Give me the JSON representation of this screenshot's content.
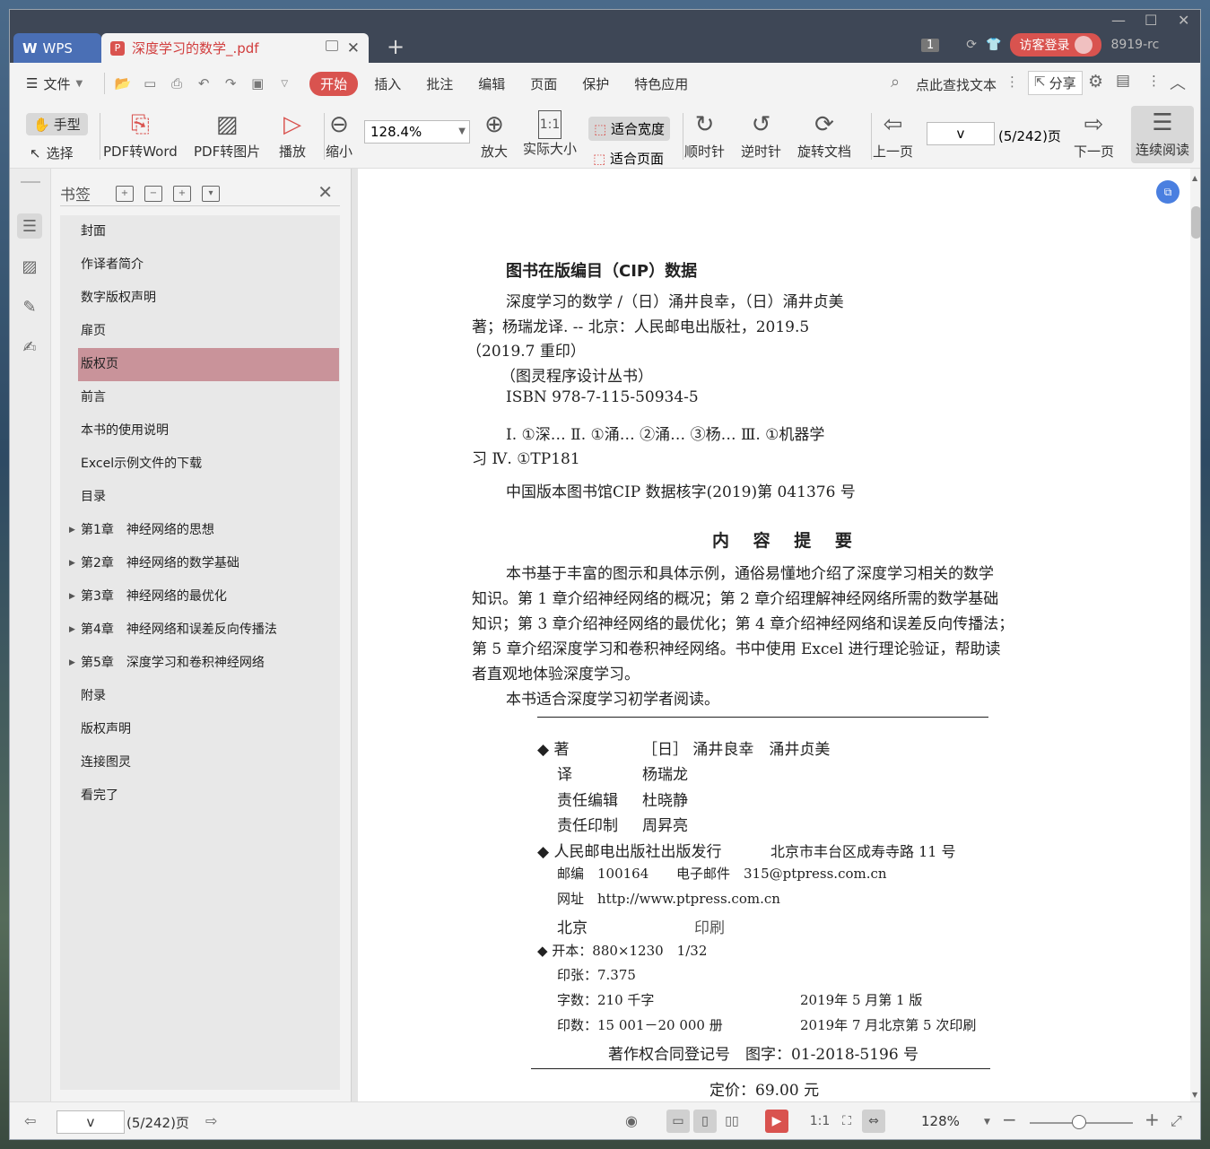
{
  "titlebar": {
    "wps_tab": "WPS",
    "doc_tab": "深度学习的数学_.pdf",
    "page_badge": "1",
    "login": "访客登录",
    "user_code": "8919-rc"
  },
  "menubar": {
    "file": "文件",
    "tabs": [
      "开始",
      "插入",
      "批注",
      "编辑",
      "页面",
      "保护",
      "特色应用"
    ],
    "search": "点此查找文本",
    "share": "分享"
  },
  "toolbar": {
    "hand": "手型",
    "select": "选择",
    "pdf_to_word": "PDF转Word",
    "pdf_to_image": "PDF转图片",
    "play": "播放",
    "zoom_out": "缩小",
    "zoom_value": "128.4%",
    "zoom_in": "放大",
    "actual_size": "实际大小",
    "fit_width": "适合宽度",
    "fit_page": "适合页面",
    "clockwise": "顺时针",
    "counterclockwise": "逆时针",
    "rotate_doc": "旋转文档",
    "prev_page": "上一页",
    "page_input": "v",
    "page_count": "(5/242)页",
    "next_page": "下一页",
    "continuous": "连续阅读"
  },
  "bookmarks": {
    "title": "书签",
    "items": [
      {
        "label": "封面",
        "expandable": false
      },
      {
        "label": "作译者简介",
        "expandable": false
      },
      {
        "label": "数字版权声明",
        "expandable": false
      },
      {
        "label": "扉页",
        "expandable": false
      },
      {
        "label": "版权页",
        "expandable": false,
        "selected": true
      },
      {
        "label": "前言",
        "expandable": false
      },
      {
        "label": "本书的使用说明",
        "expandable": false
      },
      {
        "label": "Excel示例文件的下载",
        "expandable": false
      },
      {
        "label": "目录",
        "expandable": false
      },
      {
        "label": "第1章　神经网络的思想",
        "expandable": true
      },
      {
        "label": "第2章　神经网络的数学基础",
        "expandable": true
      },
      {
        "label": "第3章　神经网络的最优化",
        "expandable": true
      },
      {
        "label": "第4章　神经网络和误差反向传播法",
        "expandable": true
      },
      {
        "label": "第5章　深度学习和卷积神经网络",
        "expandable": true
      },
      {
        "label": "附录",
        "expandable": false
      },
      {
        "label": "版权声明",
        "expandable": false
      },
      {
        "label": "连接图灵",
        "expandable": false
      },
      {
        "label": "看完了",
        "expandable": false
      }
    ]
  },
  "document": {
    "cip_title": "图书在版编目（CIP）数据",
    "cip_1": "深度学习的数学 /（日）涌井良幸，（日）涌井贞美",
    "cip_2": "著；杨瑞龙译. -- 北京：人民邮电出版社，2019.5",
    "cip_3": "（2019.7 重印）",
    "cip_4": "（图灵程序设计丛书）",
    "cip_5": "ISBN 978-7-115-50934-5",
    "cip_6": "Ⅰ. ①深… Ⅱ. ①涌… ②涌… ③杨… Ⅲ. ①机器学",
    "cip_7": "习 Ⅳ. ①TP181",
    "cip_8": "中国版本图书馆CIP 数据核字(2019)第 041376 号",
    "summary_title": "内 容 提 要",
    "summary_1": "本书基于丰富的图示和具体示例，通俗易懂地介绍了深度学习相关的数学",
    "summary_2": "知识。第 1 章介绍神经网络的概况；第 2 章介绍理解神经网络所需的数学基础",
    "summary_3": "知识；第 3 章介绍神经网络的最优化；第 4 章介绍神经网络和误差反向传播法；",
    "summary_4": "第 5 章介绍深度学习和卷积神经网络。书中使用 Excel 进行理论验证，帮助读",
    "summary_5": "者直观地体验深度学习。",
    "summary_6": "本书适合深度学习初学者阅读。",
    "author_label": "◆ 著",
    "author_value": "［日］ 涌井良幸　涌井贞美",
    "translator_label": "译",
    "translator_value": "杨瑞龙",
    "editor_label": "责任编辑",
    "editor_value": "杜晓静",
    "print_label": "责任印制",
    "print_value": "周昇亮",
    "publisher": "◆ 人民邮电出版社出版发行",
    "address": "北京市丰台区成寿寺路 11 号",
    "postcode": "邮编　100164",
    "email": "电子邮件　315@ptpress.com.cn",
    "website": "网址　http://www.ptpress.com.cn",
    "city": "北京",
    "printing": "印刷",
    "format": "◆ 开本：880×1230　1/32",
    "sheets": "印张：7.375",
    "words": "字数：210 千字",
    "edition": "2019年 5 月第 1 版",
    "copies": "印数：15 001－20 000 册",
    "reprint": "2019年 7 月北京第 5 次印刷",
    "registration": "著作权合同登记号　图字：01-2018-5196 号",
    "price": "定价：69.00 元"
  },
  "statusbar": {
    "page_input": "v",
    "page_count": "(5/242)页",
    "zoom": "128%"
  },
  "colors": {
    "accent": "#d9534f",
    "selected_bookmark": "#c9939a",
    "titlebar": "#3e4756"
  }
}
